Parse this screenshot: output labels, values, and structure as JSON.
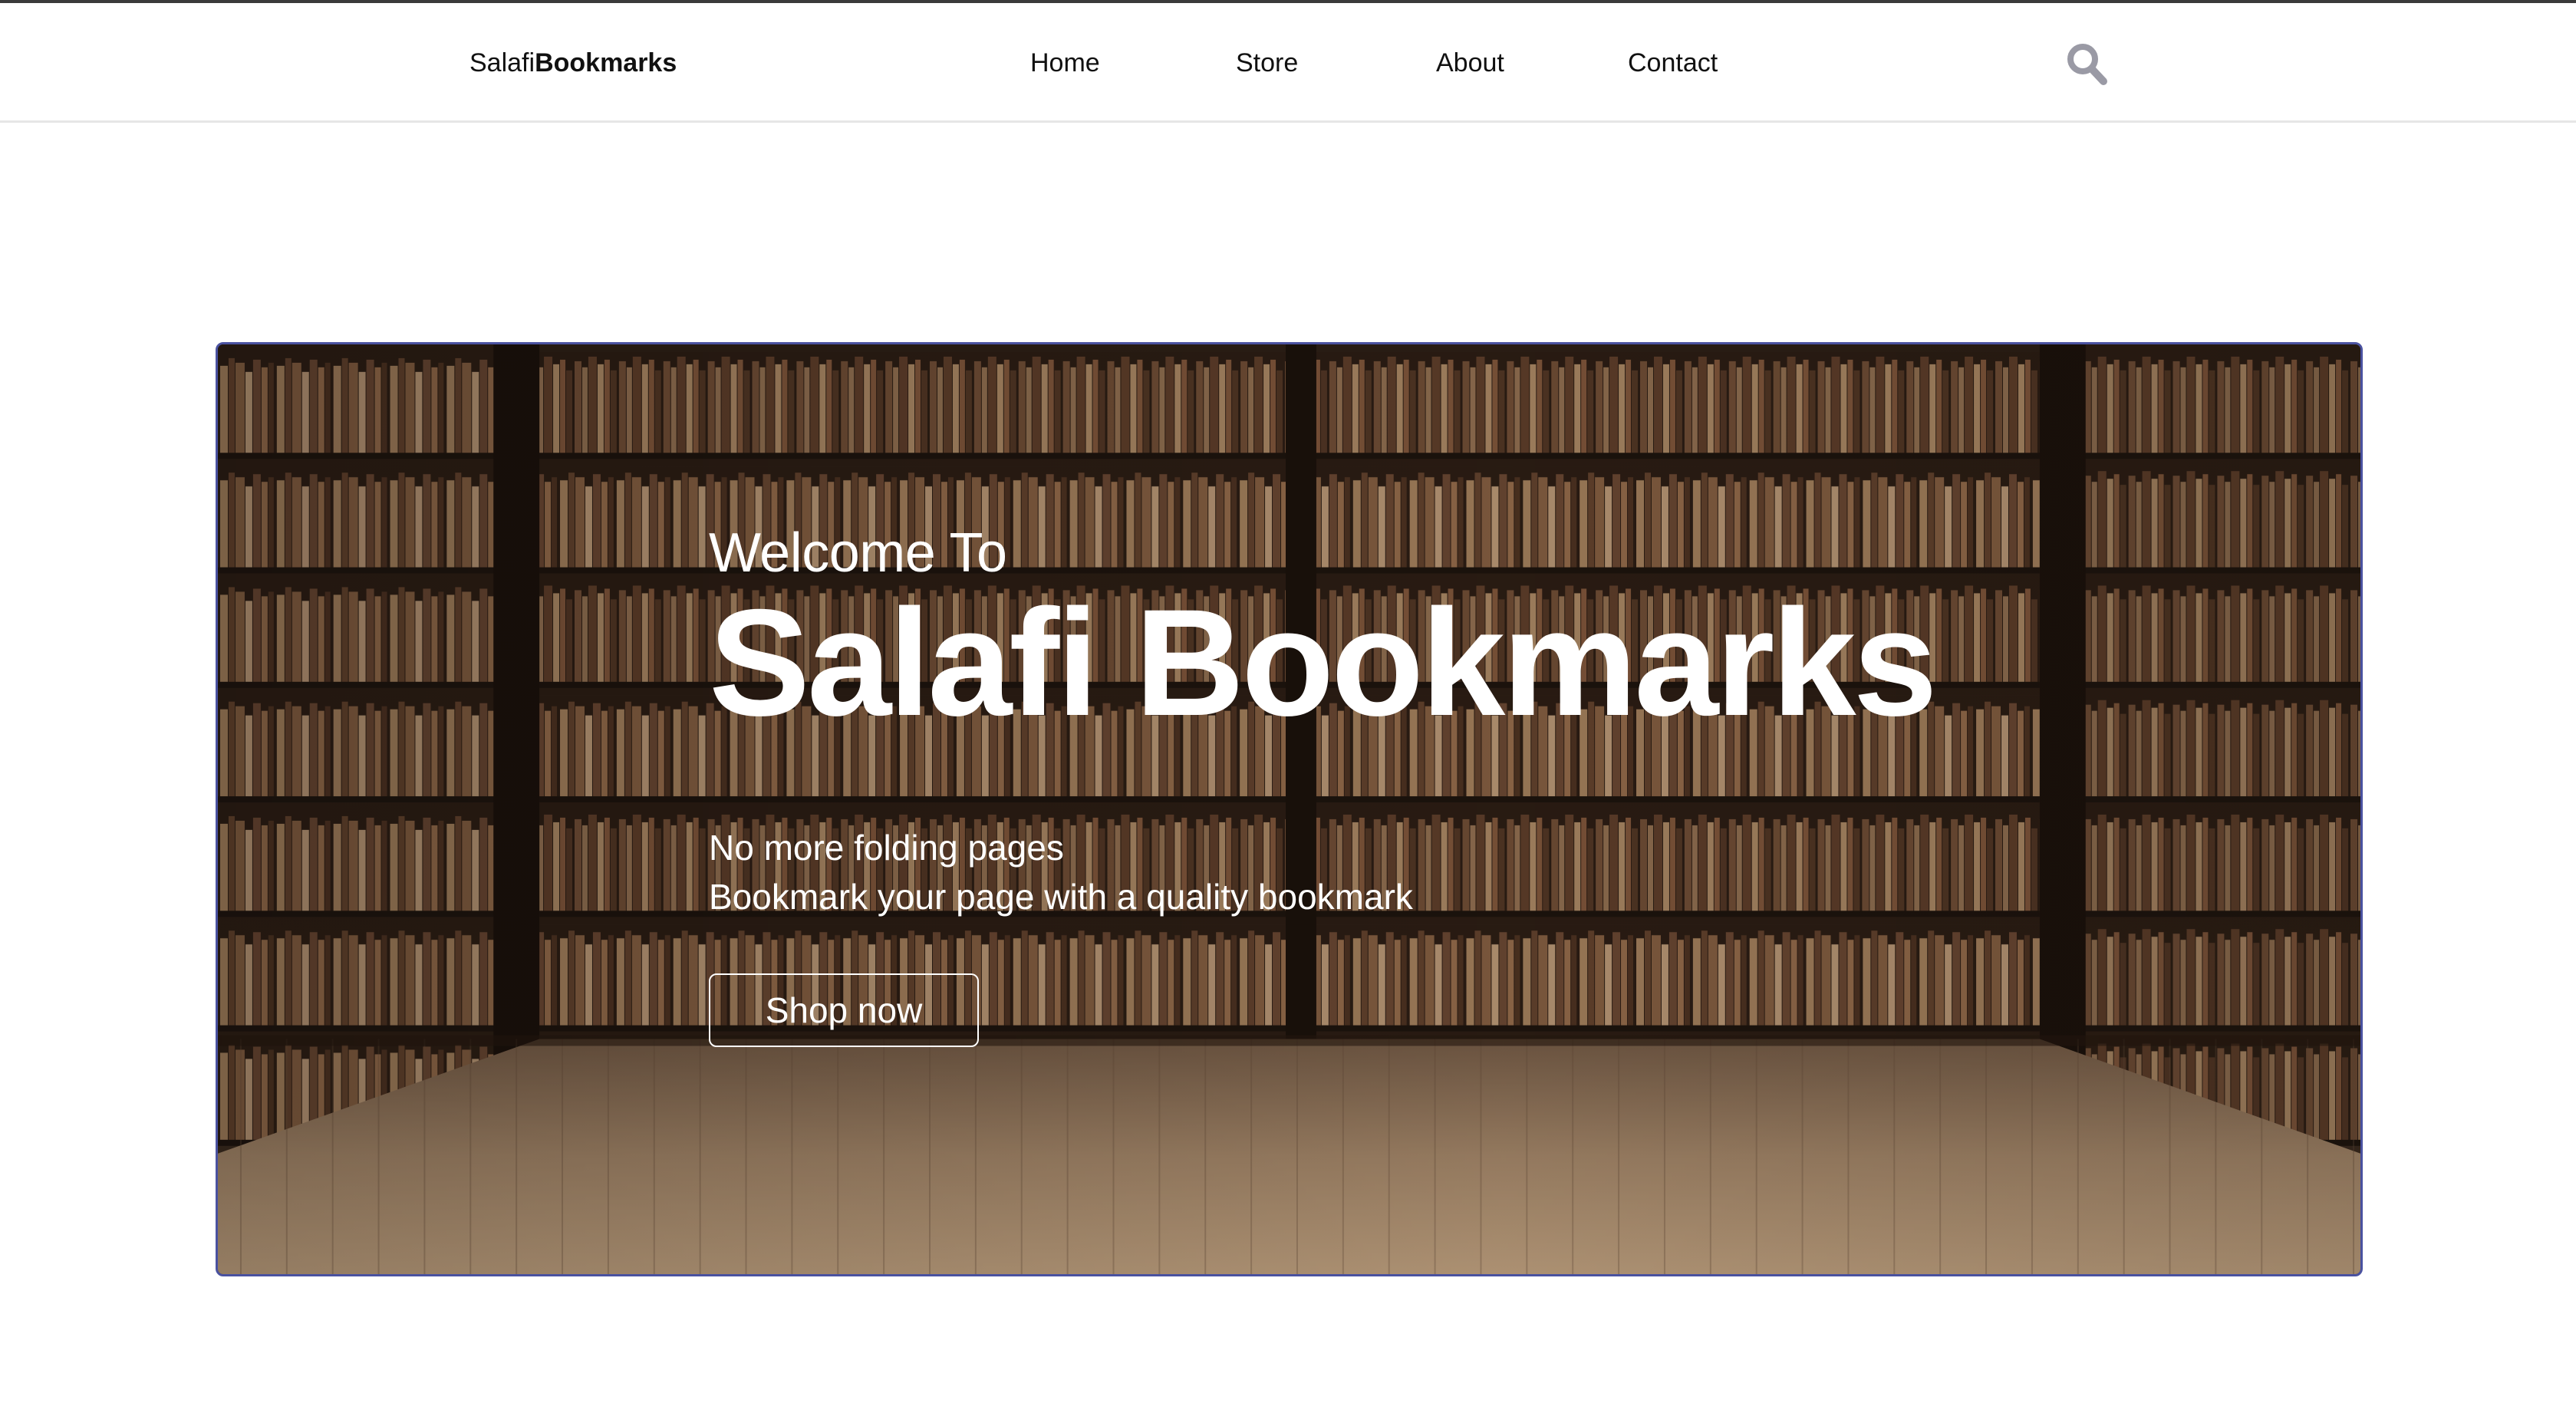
{
  "header": {
    "brand": {
      "part1": "Salafi",
      "part2": "Bookmarks"
    },
    "nav": [
      "Home",
      "Store",
      "About",
      "Contact"
    ],
    "search_icon": "search-icon"
  },
  "hero": {
    "welcome": "Welcome To",
    "title": "Salafi Bookmarks",
    "tagline_line1": "No more folding pages",
    "tagline_line2": "Bookmark your page with a quality bookmark",
    "button_label": "Shop now",
    "background": "bookshelf-library-image"
  },
  "colors": {
    "hero_border": "#4a52a0",
    "search_icon": "#9a9aa5",
    "hero_text": "#ffffff"
  }
}
